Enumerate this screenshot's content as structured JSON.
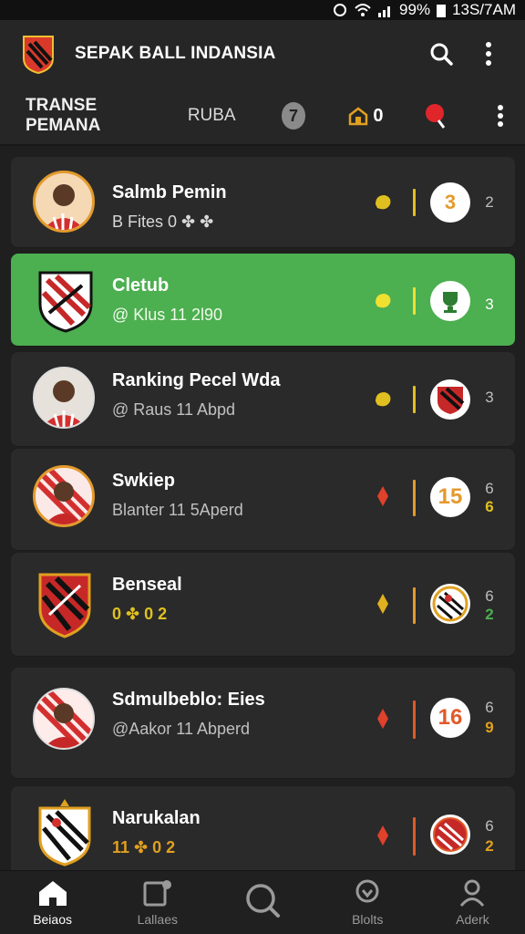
{
  "status": {
    "battery": "99%",
    "time": "13S/7AM"
  },
  "app": {
    "title": "SEPAK BALL INDANSIA"
  },
  "tabs": {
    "items": [
      {
        "label": "TRANSE PEMANA"
      },
      {
        "label": "RUBA"
      }
    ],
    "badge": "7",
    "coins": "0"
  },
  "rows": [
    {
      "name": "Salmb Pemin",
      "sub": "B Fites 0 ✤ ✤",
      "trend": "leaf",
      "rank": "3",
      "stat": "2",
      "accent": "#e39a2c"
    },
    {
      "name": "Cletub",
      "sub": "@ Klus 11 2l90",
      "trend": "leaf",
      "rank": "",
      "stat": "3",
      "accent": "#4caf50"
    },
    {
      "name": "Ranking Pecel Wda",
      "sub": "@ Raus 11 Abpd",
      "trend": "leaf",
      "rank": "",
      "stat": "3",
      "accent": "#e0c020"
    },
    {
      "name": "Swkiep",
      "sub": "Blanter 11 5Aperd",
      "trend": "arrow",
      "rank": "15",
      "stat": "6",
      "stat2": "6",
      "accent": "#e39a2c"
    },
    {
      "name": "Benseal",
      "sub": "0 ✤ 0 2",
      "trend": "arrow",
      "rank": "",
      "stat": "6",
      "stat2": "2",
      "accent": "#e39a2c"
    },
    {
      "name": "Sdmulbeblo: Eies",
      "sub": "@Aakor 11 Abperd",
      "trend": "arrow",
      "rank": "16",
      "stat": "6",
      "stat2": "9",
      "accent": "#e05a28"
    },
    {
      "name": "Narukalan",
      "sub": "11 ✤ 0 2",
      "trend": "arrow",
      "rank": "",
      "stat": "6",
      "stat2": "2",
      "accent": "#e05a28"
    }
  ],
  "nav": [
    {
      "label": "Beiaos"
    },
    {
      "label": "Lallaes"
    },
    {
      "label": ""
    },
    {
      "label": "Blolts"
    },
    {
      "label": "Aderk"
    }
  ],
  "colors": {
    "accent_green": "#4caf50",
    "orange": "#e39a2c",
    "red": "#e0412b",
    "yellow": "#e0c020"
  },
  "icons": [
    "search-icon",
    "more-icon",
    "coin-icon",
    "whistle-icon",
    "home-icon",
    "gallery-icon",
    "search-nav-icon",
    "badge-icon",
    "user-icon"
  ]
}
